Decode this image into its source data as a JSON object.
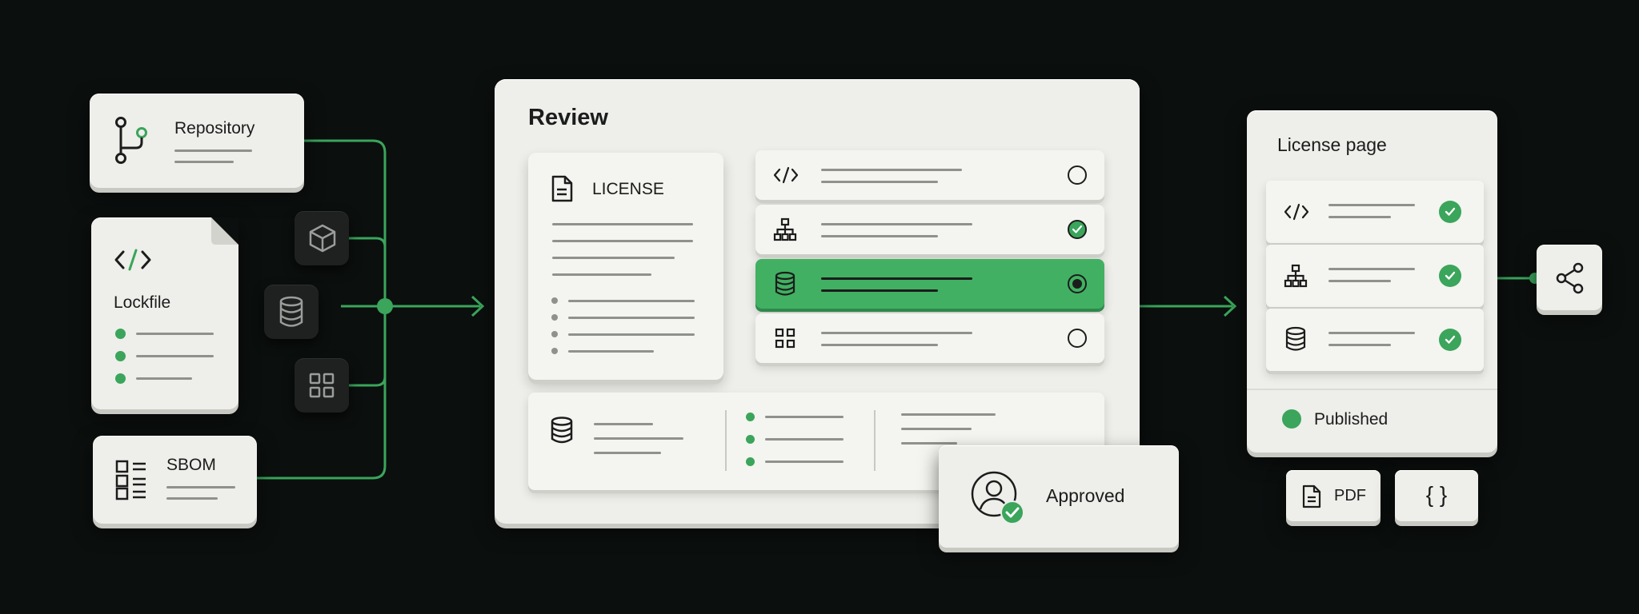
{
  "sources": {
    "repository": {
      "label": "Repository",
      "icon": "git-branch-icon"
    },
    "lockfile": {
      "label": "Lockfile",
      "icon": "code-icon"
    },
    "sbom": {
      "label": "SBOM",
      "icon": "list-icon"
    }
  },
  "review": {
    "title": "Review",
    "license_doc": {
      "label": "LICENSE",
      "icon": "document-icon"
    },
    "rows": [
      {
        "icon": "code-icon",
        "state": "unchecked"
      },
      {
        "icon": "hierarchy-icon",
        "state": "checked"
      },
      {
        "icon": "database-icon",
        "state": "selected"
      },
      {
        "icon": "grid-icon",
        "state": "unchecked"
      }
    ],
    "approved": {
      "label": "Approved",
      "icon": "user-check-icon"
    }
  },
  "publish": {
    "title": "License page",
    "rows": [
      {
        "icon": "code-icon",
        "state": "checked"
      },
      {
        "icon": "hierarchy-icon",
        "state": "checked"
      },
      {
        "icon": "database-icon",
        "state": "checked"
      }
    ],
    "status": "Published",
    "exports": {
      "pdf": "PDF",
      "json": "{ }"
    },
    "share_icon": "share-icon"
  },
  "colors": {
    "accent": "#3aa55b",
    "background": "#0b0f0e",
    "card": "#eeeeea"
  }
}
